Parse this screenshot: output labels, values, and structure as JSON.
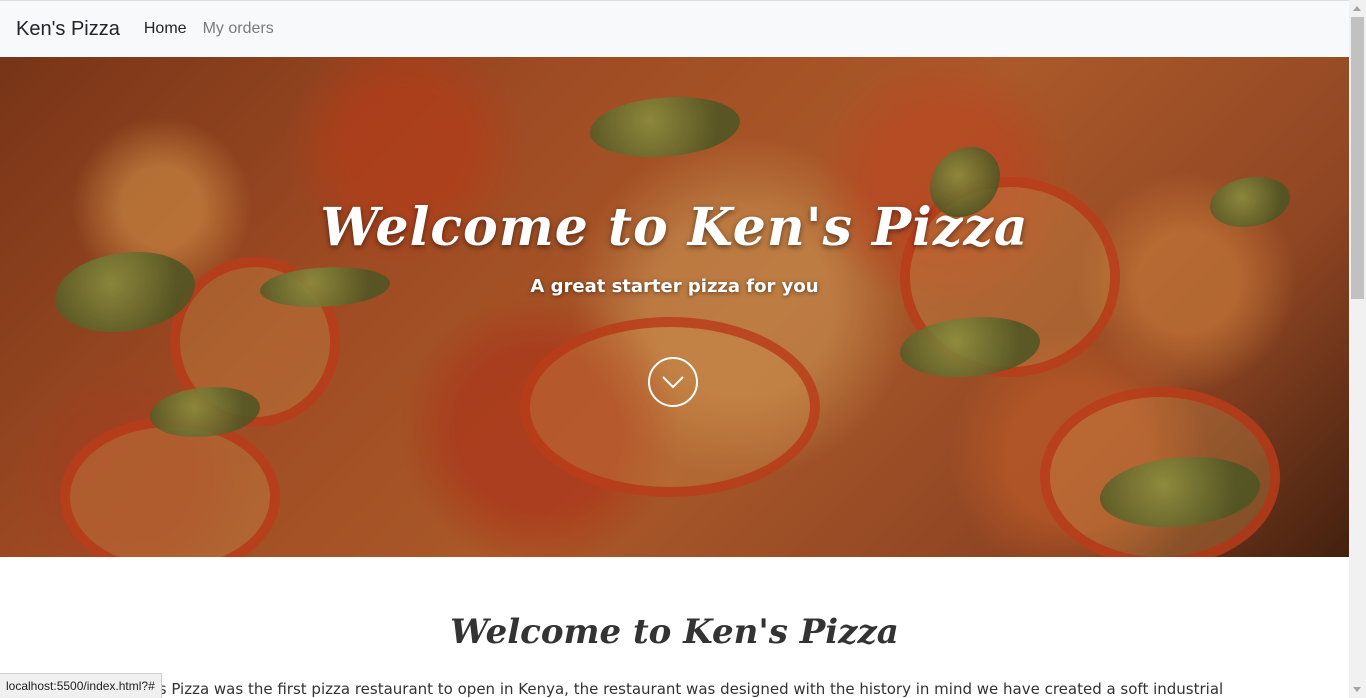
{
  "navbar": {
    "brand": "Ken's Pizza",
    "links": [
      {
        "label": "Home",
        "active": true
      },
      {
        "label": "My orders",
        "active": false
      }
    ]
  },
  "hero": {
    "title": "Welcome to Ken's Pizza",
    "subtitle": "A great starter pizza for you",
    "scroll_icon": "chevron-down-circle-icon"
  },
  "about": {
    "title": "Welcome to Ken's Pizza",
    "text": "Ken's Pizza was the first pizza restaurant to open in Kenya, the restaurant was designed with the history in mind we have created a soft industrial dining room, combined with an open kitchen."
  },
  "status_bar": {
    "url": "localhost:5500/index.html?#"
  },
  "colors": {
    "navbar_bg": "#f8f9fa",
    "hero_text": "#ffffff",
    "body_text": "#333333"
  }
}
